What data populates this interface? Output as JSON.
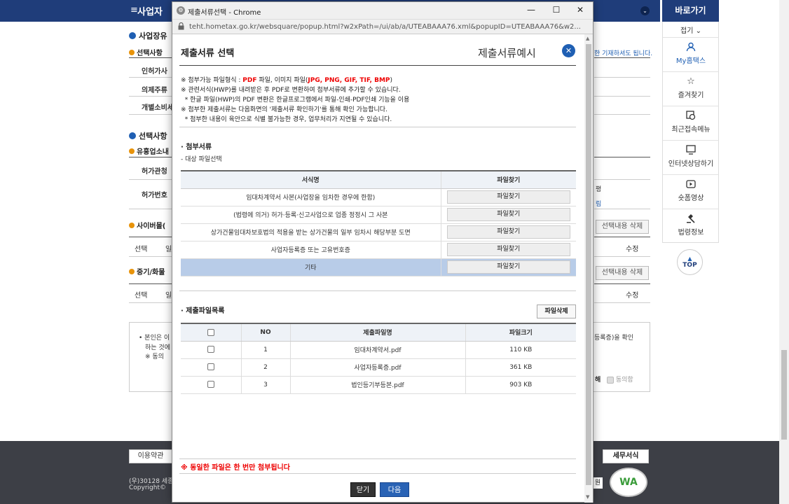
{
  "bg": {
    "menu_icon": "≡",
    "menu_title": "사업자",
    "nav_chevron": "⌄",
    "shortcut_title": "바로가기",
    "fold_label": "접기 ⌄",
    "side_items": [
      {
        "label": "My홈택스",
        "icon": "user-icon"
      },
      {
        "label": "즐겨찾기",
        "icon": "star-icon"
      },
      {
        "label": "최근접속메뉴",
        "icon": "recent-icon"
      },
      {
        "label": "인터넷상담하기",
        "icon": "chat-icon"
      },
      {
        "label": "숏폼영상",
        "icon": "play-icon"
      },
      {
        "label": "법령정보",
        "icon": "gavel-icon"
      }
    ],
    "top_button": "TOP",
    "sections": {
      "sec1": "사업장유",
      "sub1": "선택사항",
      "row1": "인허가사",
      "row2": "의제주류",
      "row3": "개별소비세",
      "sec2": "선택사항",
      "sub2": "유흥업소내",
      "row4": "허가관청",
      "row5": "허가번호",
      "sub3": "사이버몰(",
      "col_select1": "선택",
      "col_il": "일",
      "sub4": "중기/화물",
      "col_select2": "선택",
      "col_il2": "일"
    },
    "right_text": "한 기재하셔도 됩니다.",
    "right_p": "평",
    "right_link": "림",
    "btn_delete_sel1": "선택내용 삭제",
    "col_edit1": "수정",
    "btn_delete_sel2": "선택내용 삭제",
    "col_edit2": "수정",
    "agree_text1": "• 본인은 이",
    "agree_text2": "하는 것에",
    "agree_text3": "※ 동의",
    "agree_right": "등록증)을 확인",
    "agree_hae": "해",
    "agree_chk": "동의함",
    "footer_btn1": "이용약관",
    "footer_btn2": "세무서식",
    "footer_addr": "(우)30128 세종",
    "footer_copy": "Copyright© ",
    "footer_side": "원",
    "wa_logo": "WA"
  },
  "popup": {
    "window_title": "제출서류선택 - Chrome",
    "minimize": "—",
    "maximize": "☐",
    "close": "✕",
    "url": "teht.hometax.go.kr/websquare/popup.html?w2xPath=/ui/ab/a/UTEABAAA76.xml&popupID=UTEABAAA76&w2...",
    "heading": "제출서류 선택",
    "heading_right": "제출서류예시",
    "notes": [
      {
        "pre": "※ 첨부가능 파일형식 : ",
        "red1": "PDF",
        "mid": " 파일, 이미지 파일(",
        "red2": "JPG, PNG, GIF, TIF, BMP",
        "post": ")"
      },
      {
        "text": "※ 관련서식(HWP)를 내려받은 후 PDF로 변환하여 첨부서류에 추가할 수 있습니다."
      },
      {
        "text": "  * 한글 파일(HWP)의 PDF 변환은 한글프로그램에서 파일-인쇄-PDF인쇄 기능을 이용"
      },
      {
        "text": "※ 첨부한 제출서류는 다음화면의 '제출서류 확인하기'를 통해 확인 가능합니다."
      },
      {
        "text": "  * 첨부한 내용이 육안으로 식별 불가능한 경우, 업무처리가 지연될 수 있습니다."
      }
    ],
    "attach_title": "· 첨부서류",
    "attach_sub": "- 대상 파일선택",
    "form_table": {
      "headers": [
        "서식명",
        "파일찾기"
      ],
      "rows": [
        "임대차계약서 사본(사업장을 임차한 경우에 한함)",
        "(법령에 의거) 허가·등록·신고사업으로 업종 정정시 그 사본",
        "상가건물임대차보호법의 적용을 받는 상가건물의 일부 임차시 해당부분 도면",
        "사업자등록증 또는 고유번호증",
        "기타"
      ],
      "find_label": "파일찾기"
    },
    "submit_title": "· 제출파일목록",
    "delete_btn": "파일삭제",
    "file_table": {
      "headers": [
        "NO",
        "제출파일명",
        "파일크기"
      ],
      "rows": [
        {
          "no": "1",
          "name": "임대차계약서.pdf",
          "size": "110 KB"
        },
        {
          "no": "2",
          "name": "사업자등록증.pdf",
          "size": "361 KB"
        },
        {
          "no": "3",
          "name": "법인등기부등본.pdf",
          "size": "903 KB"
        }
      ]
    },
    "warning": "※ 동일한 파일은 한 번만 첨부됩니다",
    "btn_close": "닫기",
    "btn_next": "다음"
  }
}
